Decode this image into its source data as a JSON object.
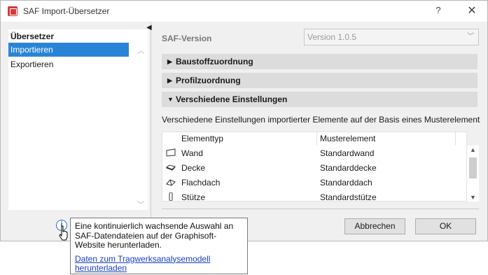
{
  "window": {
    "title": "SAF Import-Übersetzer",
    "help_label": "?",
    "close_label": "✕"
  },
  "sidebar": {
    "items": [
      {
        "label": "Übersetzer",
        "bold": true
      },
      {
        "label": "Importieren",
        "selected": true
      },
      {
        "label": "Exportieren"
      }
    ]
  },
  "main": {
    "saf_version_label": "SAF-Version",
    "version_value": "Version 1.0.5",
    "sections": [
      {
        "label": "Baustoffzuordnung",
        "expanded": false
      },
      {
        "label": "Profilzuordnung",
        "expanded": false
      },
      {
        "label": "Verschiedene Einstellungen",
        "expanded": true
      }
    ],
    "description": "Verschiedene Einstellungen importierter Elemente auf der Basis eines Musterelements fe",
    "table": {
      "headers": [
        "Elementtyp",
        "Musterelement"
      ],
      "rows": [
        {
          "type": "Wand",
          "model": "Standardwand",
          "icon": "wall-icon"
        },
        {
          "type": "Decke",
          "model": "Standarddecke",
          "icon": "slab-icon"
        },
        {
          "type": "Flachdach",
          "model": "Standarddach",
          "icon": "roof-icon"
        },
        {
          "type": "Stütze",
          "model": "Standardstütze",
          "icon": "column-icon"
        }
      ]
    }
  },
  "buttons": {
    "cancel": "Abbrechen",
    "ok": "OK"
  },
  "tooltip": {
    "info_symbol": "i",
    "text": "Eine kontinuierlich wachsende Auswahl an SAF-Datendateien auf der Graphisoft-Website herunterladen.",
    "link": "Daten zum Tragwerksanalysemodell herunterladen"
  },
  "colors": {
    "selection": "#2a84d6",
    "section_header": "#dcdcdc",
    "link": "#1a3ec8",
    "info": "#2a6cc0"
  }
}
